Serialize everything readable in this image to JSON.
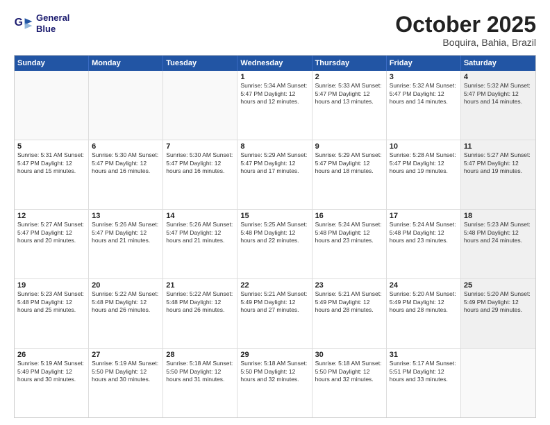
{
  "logo": {
    "line1": "General",
    "line2": "Blue"
  },
  "title": "October 2025",
  "subtitle": "Boquira, Bahia, Brazil",
  "days_of_week": [
    "Sunday",
    "Monday",
    "Tuesday",
    "Wednesday",
    "Thursday",
    "Friday",
    "Saturday"
  ],
  "weeks": [
    [
      {
        "num": "",
        "info": "",
        "empty": true
      },
      {
        "num": "",
        "info": "",
        "empty": true
      },
      {
        "num": "",
        "info": "",
        "empty": true
      },
      {
        "num": "1",
        "info": "Sunrise: 5:34 AM\nSunset: 5:47 PM\nDaylight: 12 hours\nand 12 minutes."
      },
      {
        "num": "2",
        "info": "Sunrise: 5:33 AM\nSunset: 5:47 PM\nDaylight: 12 hours\nand 13 minutes."
      },
      {
        "num": "3",
        "info": "Sunrise: 5:32 AM\nSunset: 5:47 PM\nDaylight: 12 hours\nand 14 minutes."
      },
      {
        "num": "4",
        "info": "Sunrise: 5:32 AM\nSunset: 5:47 PM\nDaylight: 12 hours\nand 14 minutes.",
        "shaded": true
      }
    ],
    [
      {
        "num": "5",
        "info": "Sunrise: 5:31 AM\nSunset: 5:47 PM\nDaylight: 12 hours\nand 15 minutes."
      },
      {
        "num": "6",
        "info": "Sunrise: 5:30 AM\nSunset: 5:47 PM\nDaylight: 12 hours\nand 16 minutes."
      },
      {
        "num": "7",
        "info": "Sunrise: 5:30 AM\nSunset: 5:47 PM\nDaylight: 12 hours\nand 16 minutes."
      },
      {
        "num": "8",
        "info": "Sunrise: 5:29 AM\nSunset: 5:47 PM\nDaylight: 12 hours\nand 17 minutes."
      },
      {
        "num": "9",
        "info": "Sunrise: 5:29 AM\nSunset: 5:47 PM\nDaylight: 12 hours\nand 18 minutes."
      },
      {
        "num": "10",
        "info": "Sunrise: 5:28 AM\nSunset: 5:47 PM\nDaylight: 12 hours\nand 19 minutes."
      },
      {
        "num": "11",
        "info": "Sunrise: 5:27 AM\nSunset: 5:47 PM\nDaylight: 12 hours\nand 19 minutes.",
        "shaded": true
      }
    ],
    [
      {
        "num": "12",
        "info": "Sunrise: 5:27 AM\nSunset: 5:47 PM\nDaylight: 12 hours\nand 20 minutes."
      },
      {
        "num": "13",
        "info": "Sunrise: 5:26 AM\nSunset: 5:47 PM\nDaylight: 12 hours\nand 21 minutes."
      },
      {
        "num": "14",
        "info": "Sunrise: 5:26 AM\nSunset: 5:47 PM\nDaylight: 12 hours\nand 21 minutes."
      },
      {
        "num": "15",
        "info": "Sunrise: 5:25 AM\nSunset: 5:48 PM\nDaylight: 12 hours\nand 22 minutes."
      },
      {
        "num": "16",
        "info": "Sunrise: 5:24 AM\nSunset: 5:48 PM\nDaylight: 12 hours\nand 23 minutes."
      },
      {
        "num": "17",
        "info": "Sunrise: 5:24 AM\nSunset: 5:48 PM\nDaylight: 12 hours\nand 23 minutes."
      },
      {
        "num": "18",
        "info": "Sunrise: 5:23 AM\nSunset: 5:48 PM\nDaylight: 12 hours\nand 24 minutes.",
        "shaded": true
      }
    ],
    [
      {
        "num": "19",
        "info": "Sunrise: 5:23 AM\nSunset: 5:48 PM\nDaylight: 12 hours\nand 25 minutes."
      },
      {
        "num": "20",
        "info": "Sunrise: 5:22 AM\nSunset: 5:48 PM\nDaylight: 12 hours\nand 26 minutes."
      },
      {
        "num": "21",
        "info": "Sunrise: 5:22 AM\nSunset: 5:48 PM\nDaylight: 12 hours\nand 26 minutes."
      },
      {
        "num": "22",
        "info": "Sunrise: 5:21 AM\nSunset: 5:49 PM\nDaylight: 12 hours\nand 27 minutes."
      },
      {
        "num": "23",
        "info": "Sunrise: 5:21 AM\nSunset: 5:49 PM\nDaylight: 12 hours\nand 28 minutes."
      },
      {
        "num": "24",
        "info": "Sunrise: 5:20 AM\nSunset: 5:49 PM\nDaylight: 12 hours\nand 28 minutes."
      },
      {
        "num": "25",
        "info": "Sunrise: 5:20 AM\nSunset: 5:49 PM\nDaylight: 12 hours\nand 29 minutes.",
        "shaded": true
      }
    ],
    [
      {
        "num": "26",
        "info": "Sunrise: 5:19 AM\nSunset: 5:49 PM\nDaylight: 12 hours\nand 30 minutes."
      },
      {
        "num": "27",
        "info": "Sunrise: 5:19 AM\nSunset: 5:50 PM\nDaylight: 12 hours\nand 30 minutes."
      },
      {
        "num": "28",
        "info": "Sunrise: 5:18 AM\nSunset: 5:50 PM\nDaylight: 12 hours\nand 31 minutes."
      },
      {
        "num": "29",
        "info": "Sunrise: 5:18 AM\nSunset: 5:50 PM\nDaylight: 12 hours\nand 32 minutes."
      },
      {
        "num": "30",
        "info": "Sunrise: 5:18 AM\nSunset: 5:50 PM\nDaylight: 12 hours\nand 32 minutes."
      },
      {
        "num": "31",
        "info": "Sunrise: 5:17 AM\nSunset: 5:51 PM\nDaylight: 12 hours\nand 33 minutes."
      },
      {
        "num": "",
        "info": "",
        "empty": true,
        "shaded": true
      }
    ]
  ]
}
